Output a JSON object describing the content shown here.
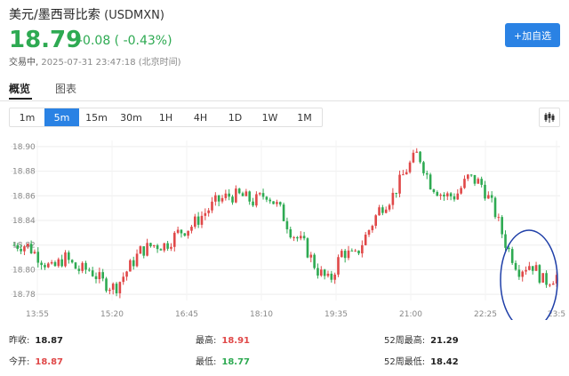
{
  "header": {
    "name": "美元/墨西哥比索",
    "symbol": "(USDMXN)",
    "price": "18.79",
    "change": "-0.08 ( -0.43%)",
    "status": "交易中,",
    "time": "2025-07-31 23:47:18 (北京时间)",
    "add_button": "+加自选"
  },
  "tabs": [
    "概览",
    "图表"
  ],
  "periods": [
    "1m",
    "5m",
    "15m",
    "30m",
    "1H",
    "4H",
    "1D",
    "1W",
    "1M"
  ],
  "active_period": "5m",
  "colors": {
    "up": "#e04848",
    "down": "#2eaa52",
    "accent": "#2a82e4",
    "annotation": "#1f3fa8"
  },
  "chart_data": {
    "type": "candlestick",
    "xlabels": [
      "13:55",
      "15:20",
      "16:45",
      "18:10",
      "19:35",
      "21:00",
      "22:25",
      "23:5"
    ],
    "yticks": [
      "18.90",
      "18.88",
      "18.86",
      "18.84",
      "18.82",
      "18.80",
      "18.78"
    ],
    "ylim": [
      18.775,
      18.905
    ],
    "close_path": [
      18.82,
      18.82,
      18.81,
      18.8,
      18.81,
      18.8,
      18.8,
      18.79,
      18.785,
      18.8,
      18.815,
      18.82,
      18.82,
      18.83,
      18.835,
      18.845,
      18.855,
      18.86,
      18.86,
      18.855,
      18.862,
      18.85,
      18.83,
      18.82,
      18.8,
      18.79,
      18.815,
      18.81,
      18.83,
      18.85,
      18.86,
      18.88,
      18.895,
      18.87,
      18.86,
      18.86,
      18.875,
      18.87,
      18.85,
      18.82,
      18.8,
      18.805,
      18.79,
      18.795
    ],
    "grid": true,
    "annotation": "ellipse around last candles"
  },
  "stats": {
    "prev_close_label": "昨收:",
    "prev_close": "18.87",
    "open_label": "今开:",
    "open": "18.87",
    "high_label": "最高:",
    "high": "18.91",
    "low_label": "最低:",
    "low": "18.77",
    "w52_high_label": "52周最高:",
    "w52_high": "21.29",
    "w52_low_label": "52周最低:",
    "w52_low": "18.42"
  }
}
